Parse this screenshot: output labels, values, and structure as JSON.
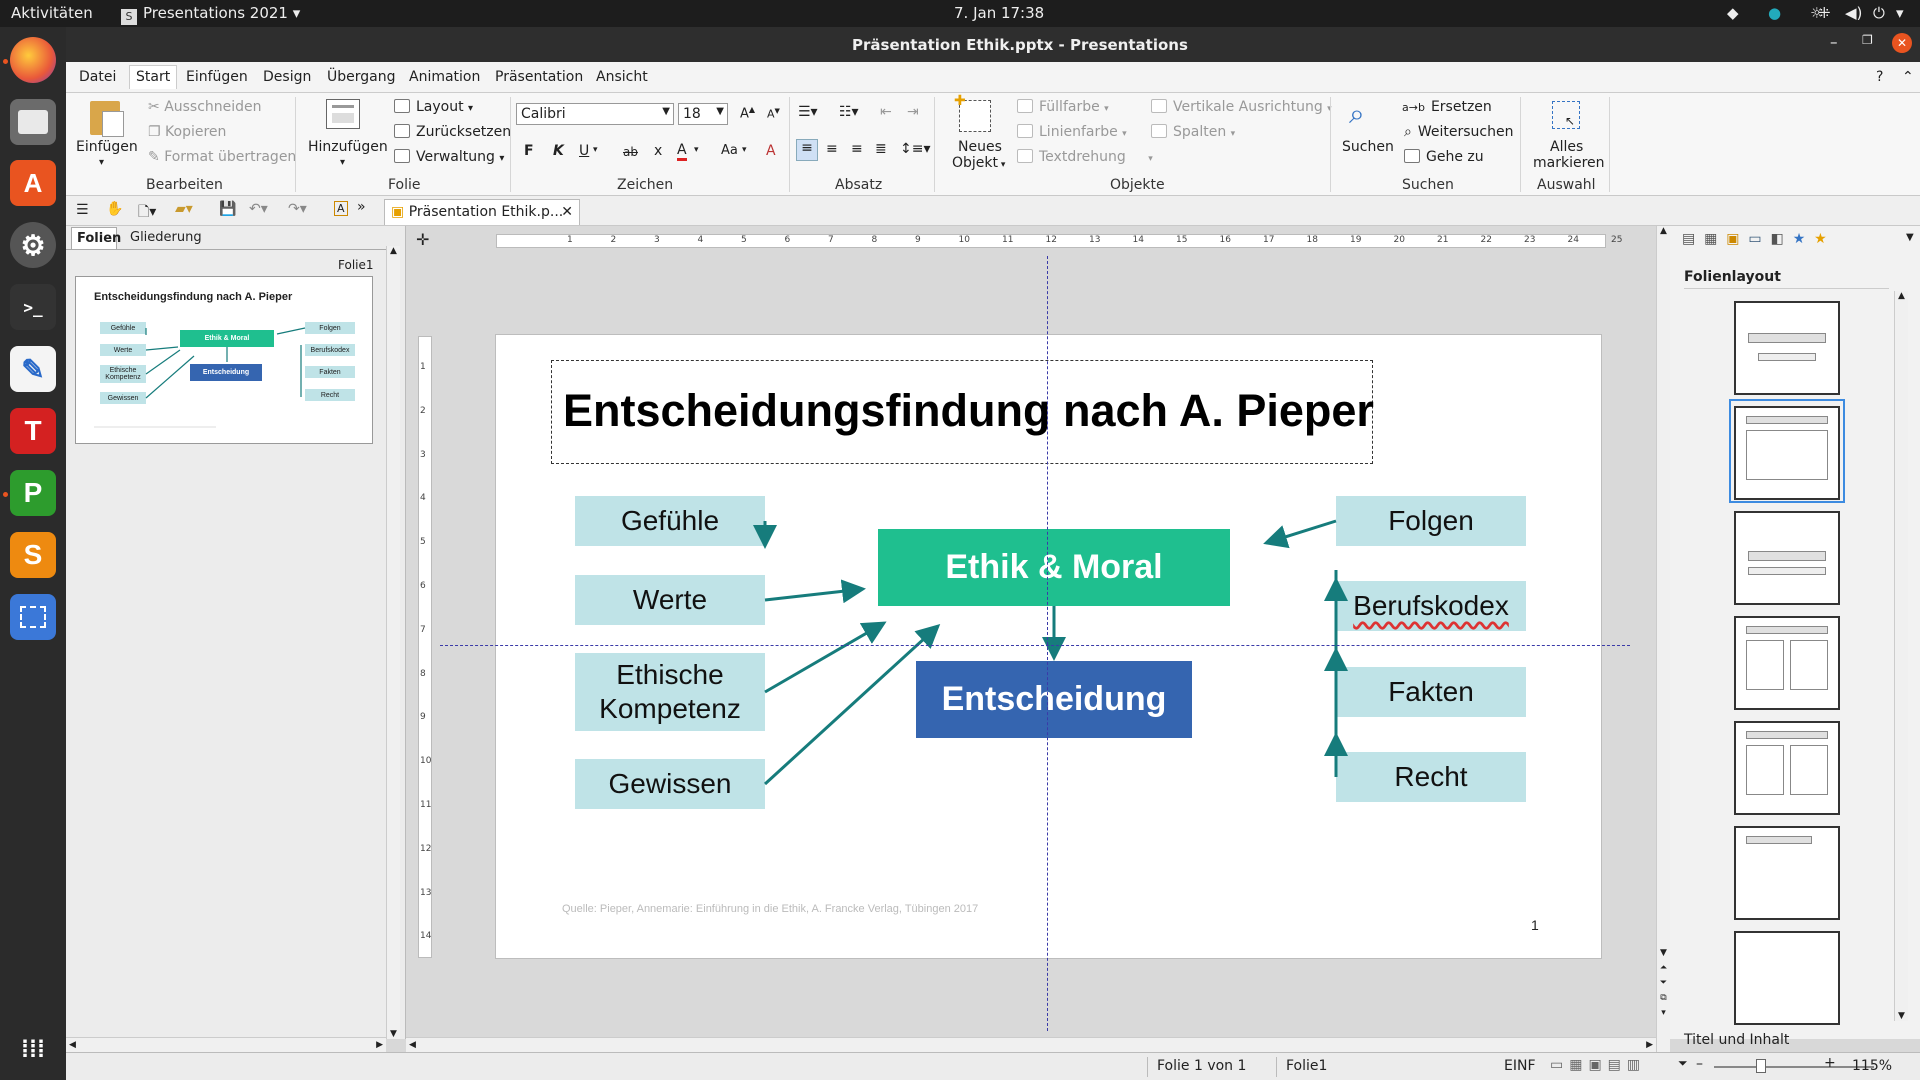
{
  "topbar": {
    "activities": "Aktivitäten",
    "app_menu": "Presentations 2021",
    "clock": "7. Jan  17:38"
  },
  "window": {
    "title": "Präsentation Ethik.pptx - Presentations"
  },
  "menu": [
    "Datei",
    "Start",
    "Einfügen",
    "Design",
    "Übergang",
    "Animation",
    "Präsentation",
    "Ansicht"
  ],
  "ribbon": {
    "bearbeiten": {
      "paste": "Einfügen",
      "cut": "Ausschneiden",
      "copy": "Kopieren",
      "format": "Format übertragen",
      "group": "Bearbeiten"
    },
    "folie": {
      "add": "Hinzufügen",
      "layout": "Layout",
      "reset": "Zurücksetzen",
      "manage": "Verwaltung",
      "group": "Folie"
    },
    "zeichen": {
      "font": "Calibri",
      "size": "18",
      "bold": "F",
      "italic": "K",
      "underline": "U",
      "strike": "ab",
      "group": "Zeichen"
    },
    "absatz": {
      "group": "Absatz"
    },
    "objekte": {
      "new_line1": "Neues",
      "new_line2": "Objekt",
      "fill": "Füllfarbe",
      "line": "Linienfarbe",
      "rotate": "Textdrehung",
      "valign": "Vertikale Ausrichtung",
      "columns": "Spalten",
      "group": "Objekte"
    },
    "suchen": {
      "search": "Suchen",
      "replace": "Ersetzen",
      "find_next": "Weitersuchen",
      "goto": "Gehe zu",
      "group": "Suchen"
    },
    "auswahl": {
      "all_line1": "Alles",
      "all_line2": "markieren",
      "group": "Auswahl"
    }
  },
  "doc_tab": "Präsentation Ethik.p...",
  "left_panel": {
    "tab_slides": "Folien",
    "tab_outline": "Gliederung",
    "slide_label": "Folie1"
  },
  "ruler_h": [
    "1",
    "2",
    "3",
    "4",
    "5",
    "6",
    "7",
    "8",
    "9",
    "10",
    "11",
    "12",
    "13",
    "14",
    "15",
    "16",
    "17",
    "18",
    "19",
    "20",
    "21",
    "22",
    "23",
    "24",
    "25"
  ],
  "ruler_v": [
    "1",
    "2",
    "3",
    "4",
    "5",
    "6",
    "7",
    "8",
    "9",
    "10",
    "11",
    "12",
    "13",
    "14"
  ],
  "slide": {
    "title": "Entscheidungsfindung nach A. Pieper",
    "left_boxes": [
      "Gefühle",
      "Werte",
      "Ethische Kompetenz",
      "Gewissen"
    ],
    "center_top": "Ethik & Moral",
    "center_bottom": "Entscheidung",
    "right_boxes": [
      "Folgen",
      "Berufskodex",
      "Fakten",
      "Recht"
    ],
    "source": "Quelle: Pieper, Annemarie: Einführung in die Ethik, A. Francke Verlag, Tübingen 2017",
    "page_number": "1",
    "colors": {
      "teal": "#1fbf8f",
      "blue": "#3565b0",
      "light": "#bfe3e7",
      "arrow": "#167c7c"
    }
  },
  "thumbnail": {
    "title": "Entscheidungsfindung nach A. Pieper",
    "left_boxes": [
      "Gefühle",
      "Werte",
      "Ethische Kompetenz",
      "Gewissen"
    ],
    "center_top": "Ethik & Moral",
    "center_bottom": "Entscheidung",
    "right_boxes": [
      "Folgen",
      "Berufskodex",
      "Fakten",
      "Recht"
    ]
  },
  "right_panel": {
    "title": "Folienlayout",
    "footer": "Titel und Inhalt"
  },
  "status": {
    "slide_of": "Folie 1 von 1",
    "slide_name": "Folie1",
    "mode": "EINF",
    "zoom": "115%"
  }
}
